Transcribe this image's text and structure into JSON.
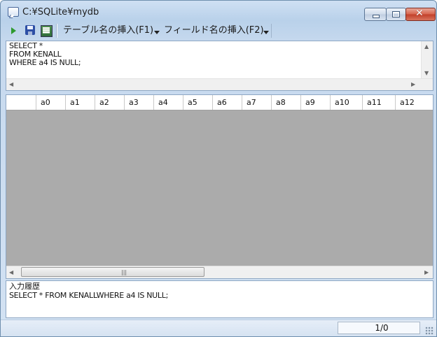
{
  "window": {
    "title": "C:¥SQLite¥mydb"
  },
  "toolbar": {
    "menu1": "テーブル名の挿入(F1)",
    "menu2": "フィールド名の挿入(F2)"
  },
  "editor": {
    "sql": "SELECT *\nFROM KENALL\nWHERE a4 IS NULL;"
  },
  "grid": {
    "columns": [
      "a0",
      "a1",
      "a2",
      "a3",
      "a4",
      "a5",
      "a6",
      "a7",
      "a8",
      "a9",
      "a10",
      "a11",
      "a12"
    ],
    "rows": []
  },
  "history": {
    "label": "入力履歴",
    "text": "SELECT * FROM KENALLWHERE a4 IS NULL;"
  },
  "status": {
    "page_indicator": "1/0"
  },
  "colors": {
    "grid_background": "#ababab",
    "title_bar": "#cfe0f3",
    "close_button": "#c2402a"
  }
}
